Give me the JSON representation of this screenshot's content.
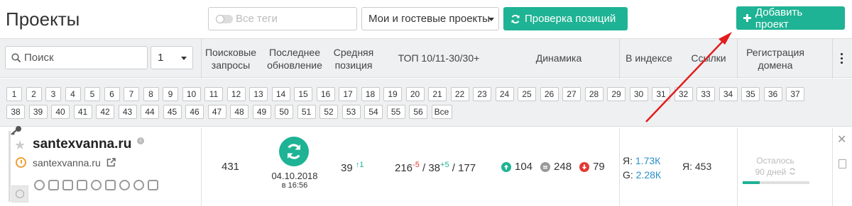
{
  "header": {
    "title": "Проекты",
    "tags_placeholder": "Все теги",
    "project_filter": "Мои и гостевые проекты",
    "check_positions_label": "Проверка позиций",
    "add_project_label": "Добавить проект"
  },
  "colors": {
    "accent": "#1eb394",
    "link": "#2a8fc7",
    "negative": "#e53935",
    "header_bg": "#eef0f2"
  },
  "table_header": {
    "search_placeholder": "Поиск",
    "page_select": "1",
    "columns": [
      {
        "l1": "Поисковые",
        "l2": "запросы"
      },
      {
        "l1": "Последнее",
        "l2": "обновление"
      },
      {
        "l1": "Средняя",
        "l2": "позиция"
      },
      {
        "l1": "ТОП 10/11-30/30+",
        "l2": ""
      },
      {
        "l1": "Динамика",
        "l2": ""
      },
      {
        "l1": "В индексе",
        "l2": ""
      },
      {
        "l1": "Ссылки",
        "l2": ""
      },
      {
        "l1": "Регистрация",
        "l2": "домена"
      }
    ]
  },
  "pagination": {
    "row1": [
      "1",
      "2",
      "3",
      "4",
      "5",
      "6",
      "7",
      "8",
      "9",
      "10",
      "11",
      "12",
      "13",
      "14",
      "15",
      "16",
      "17",
      "18",
      "19",
      "20",
      "21",
      "22",
      "23",
      "24",
      "25",
      "26",
      "27",
      "28",
      "29",
      "30",
      "31",
      "32",
      "33",
      "34",
      "35",
      "36",
      "37"
    ],
    "row2": [
      "38",
      "39",
      "40",
      "41",
      "42",
      "43",
      "44",
      "45",
      "46",
      "47",
      "48",
      "49",
      "50",
      "51",
      "52",
      "53",
      "54",
      "55",
      "56",
      "Все"
    ]
  },
  "project": {
    "domain": "santexvanna.ru",
    "subdomain": "santexvanna.ru",
    "queries": "431",
    "updated_date": "04.10.2018",
    "updated_time": "в 16:56",
    "avg_position": "39",
    "avg_change": "1",
    "top10": "216",
    "top10_change": "-5",
    "top30": "38",
    "top30_change": "+5",
    "top30plus": "177",
    "dyn_up": "104",
    "dyn_same": "248",
    "dyn_down": "79",
    "index_y_label": "Я:",
    "index_y": "1.73К",
    "index_g_label": "G:",
    "index_g": "2.28К",
    "links": "Я: 453",
    "remain_label": "Осталось",
    "remain_days": "90 дней",
    "remain_fraction": 0.25
  }
}
